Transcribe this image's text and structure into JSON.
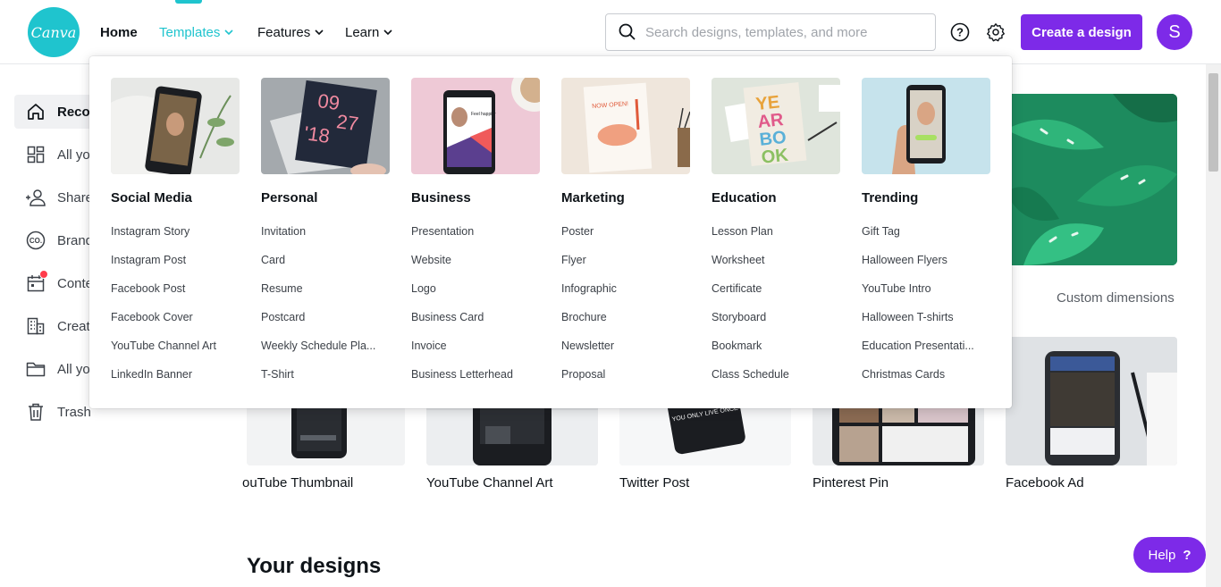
{
  "brand": {
    "logo_text": "Canva"
  },
  "nav": {
    "home": "Home",
    "templates": "Templates",
    "features": "Features",
    "learn": "Learn"
  },
  "search": {
    "placeholder": "Search designs, templates, and more"
  },
  "header": {
    "create_label": "Create a design",
    "avatar_initial": "S"
  },
  "sidebar": {
    "items": [
      {
        "label": "Recon",
        "icon": "home-icon"
      },
      {
        "label": "All yo",
        "icon": "grid-icon"
      },
      {
        "label": "Share",
        "icon": "shared-users-icon"
      },
      {
        "label": "Brand",
        "icon": "brand-kit-icon"
      },
      {
        "label": "Conte",
        "icon": "calendar-icon"
      },
      {
        "label": "Creat",
        "icon": "building-icon"
      },
      {
        "label": "All yo",
        "icon": "folder-icon"
      },
      {
        "label": "Trash",
        "icon": "trash-icon"
      }
    ]
  },
  "main": {
    "custom_dimensions": "Custom dimensions",
    "cards": [
      {
        "label": "ouTube Thumbnail"
      },
      {
        "label": "YouTube Channel Art"
      },
      {
        "label": "Twitter Post"
      },
      {
        "label": "Pinterest Pin"
      },
      {
        "label": "Facebook Ad"
      }
    ],
    "your_designs": "Your designs",
    "twitter_phone_text": "YOU ONLY LIVE ONCE"
  },
  "help": {
    "label": "Help",
    "icon": "?"
  },
  "dropdown": {
    "columns": [
      {
        "heading": "Social Media",
        "items": [
          "Instagram Story",
          "Instagram Post",
          "Facebook Post",
          "Facebook Cover",
          "YouTube Channel Art",
          "LinkedIn Banner"
        ]
      },
      {
        "heading": "Personal",
        "items": [
          "Invitation",
          "Card",
          "Resume",
          "Postcard",
          "Weekly Schedule Pla...",
          "T-Shirt"
        ],
        "thumb_text": [
          "09",
          "27",
          "'18"
        ]
      },
      {
        "heading": "Business",
        "items": [
          "Presentation",
          "Website",
          "Logo",
          "Business Card",
          "Invoice",
          "Business Letterhead"
        ],
        "thumb_text": "Feel happier"
      },
      {
        "heading": "Marketing",
        "items": [
          "Poster",
          "Flyer",
          "Infographic",
          "Brochure",
          "Newsletter",
          "Proposal"
        ],
        "thumb_text": "NOW OPEN!"
      },
      {
        "heading": "Education",
        "items": [
          "Lesson Plan",
          "Worksheet",
          "Certificate",
          "Storyboard",
          "Bookmark",
          "Class Schedule"
        ],
        "thumb_text": [
          "YE",
          "AR",
          "BO",
          "OK"
        ]
      },
      {
        "heading": "Trending",
        "items": [
          "Gift Tag",
          "Halloween Flyers",
          "YouTube Intro",
          "Halloween T-shirts",
          "Education Presentati...",
          "Christmas Cards"
        ]
      }
    ]
  },
  "colors": {
    "accent": "#1fc4ce",
    "brand_purple": "#7d2ae8",
    "notification": "#ff3b4b"
  }
}
